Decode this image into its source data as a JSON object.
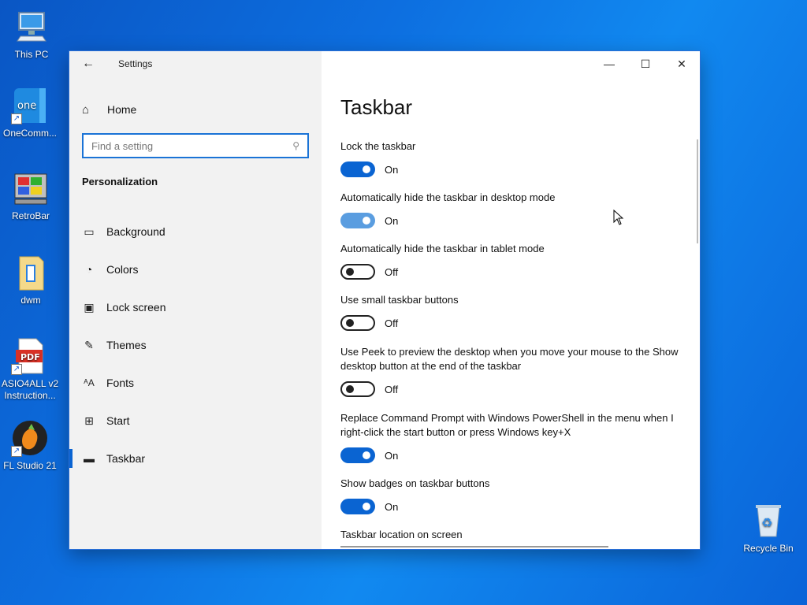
{
  "desktop": {
    "icons": [
      {
        "label": "This PC"
      },
      {
        "label": "OneComm..."
      },
      {
        "label": "RetroBar"
      },
      {
        "label": "dwm"
      },
      {
        "label": "ASIO4ALL v2 Instruction..."
      },
      {
        "label": "FL Studio 21"
      },
      {
        "label": "Recycle Bin"
      }
    ],
    "pdf_badge": "PDF"
  },
  "window": {
    "app_title": "Settings",
    "controls": {
      "minimize": "—",
      "maximize": "☐",
      "close": "✕"
    }
  },
  "sidebar": {
    "home_label": "Home",
    "search_placeholder": "Find a setting",
    "section_title": "Personalization",
    "items": [
      {
        "label": "Background",
        "icon": "image-icon"
      },
      {
        "label": "Colors",
        "icon": "palette-icon"
      },
      {
        "label": "Lock screen",
        "icon": "lock-screen-icon"
      },
      {
        "label": "Themes",
        "icon": "themes-icon"
      },
      {
        "label": "Fonts",
        "icon": "fonts-icon"
      },
      {
        "label": "Start",
        "icon": "start-icon"
      },
      {
        "label": "Taskbar",
        "icon": "taskbar-icon",
        "active": true
      }
    ]
  },
  "main": {
    "title": "Taskbar",
    "settings": [
      {
        "label": "Lock the taskbar",
        "state": "On"
      },
      {
        "label": "Automatically hide the taskbar in desktop mode",
        "state": "On"
      },
      {
        "label": "Automatically hide the taskbar in tablet mode",
        "state": "Off"
      },
      {
        "label": "Use small taskbar buttons",
        "state": "Off"
      },
      {
        "label": "Use Peek to preview the desktop when you move your mouse to the Show desktop button at the end of the taskbar",
        "state": "Off"
      },
      {
        "label": "Replace Command Prompt with Windows PowerShell in the menu when I right-click the start button or press Windows key+X",
        "state": "On"
      },
      {
        "label": "Show badges on taskbar buttons",
        "state": "On"
      }
    ],
    "location_label": "Taskbar location on screen"
  },
  "colors": {
    "accent": "#0a64d2"
  }
}
